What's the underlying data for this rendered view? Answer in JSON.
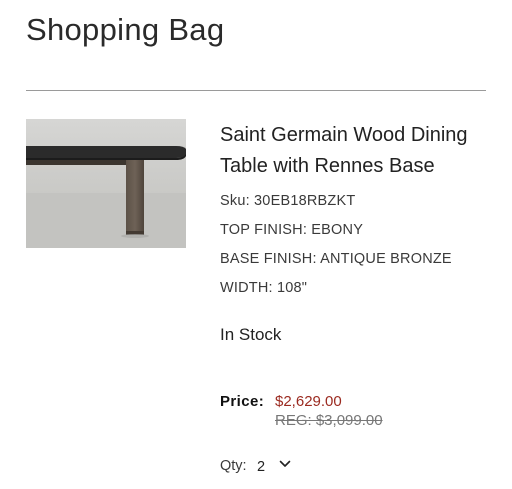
{
  "page": {
    "title": "Shopping Bag"
  },
  "item": {
    "image": {
      "icon": "product-photo-table"
    },
    "name": "Saint Germain Wood Dining Table with Rennes Base",
    "sku": "Sku: 30EB18RBZKT",
    "top_finish": "TOP FINISH: EBONY",
    "base_finish": "BASE FINISH: ANTIQUE BRONZE",
    "width": "WIDTH: 108\"",
    "stock_status": "In Stock",
    "price": {
      "label": "Price:",
      "sale": "$2,629.00",
      "regular": "REG: $3,099.00"
    },
    "quantity": {
      "label": "Qty:",
      "value": "2"
    }
  },
  "colors": {
    "sale_price": "#9b2a20",
    "regular_price": "#777777",
    "divider": "#9a9a9a"
  }
}
